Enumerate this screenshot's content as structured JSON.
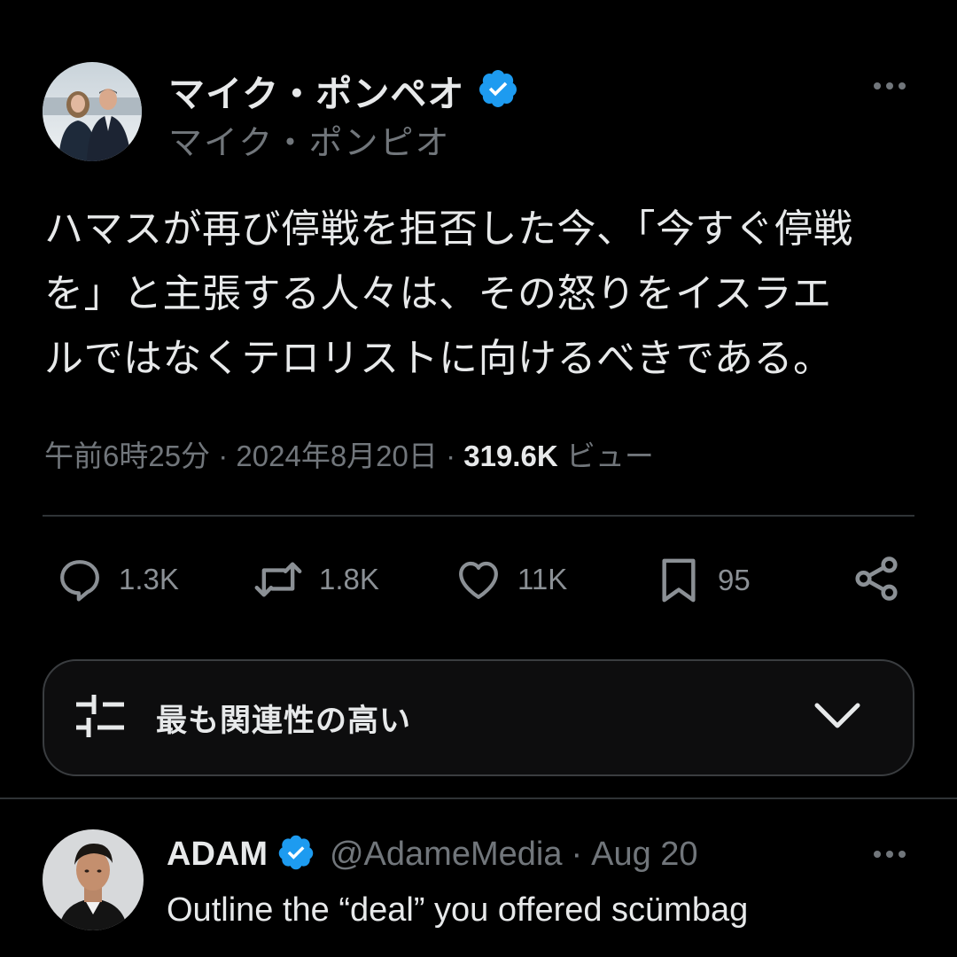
{
  "colors": {
    "background": "#000000",
    "text_primary": "#e7e9ea",
    "text_secondary": "#71767b",
    "verified_blue": "#1d9bf0",
    "divider": "#2f3336"
  },
  "tweet": {
    "author": {
      "display_name": "マイク・ポンペオ",
      "handle": "マイク・ポンピオ",
      "verified": true
    },
    "text_lines": [
      "ハマスが再び停戦を拒否した今、「今すぐ停戦",
      "を」と主張する人々は、その怒りをイスラエ",
      "ルではなくテロリストに向けるべきである。"
    ],
    "time": "午前6時25分",
    "separator": "·",
    "date": "2024年8月20日",
    "views_count": "319.6K",
    "views_label": "ビュー"
  },
  "actions": {
    "replies": "1.3K",
    "retweets": "1.8K",
    "likes": "11K",
    "bookmarks": "95",
    "icons": [
      "reply-icon",
      "retweet-icon",
      "like-icon",
      "bookmark-icon",
      "share-icon"
    ]
  },
  "sort": {
    "label": "最も関連性の高い",
    "icon": "filter-sliders-icon"
  },
  "reply": {
    "display_name": "ADAM",
    "verified": true,
    "handle": "@AdameMedia",
    "separator": "·",
    "date": "Aug 20",
    "text": "Outline the “deal” you offered scümbag"
  }
}
